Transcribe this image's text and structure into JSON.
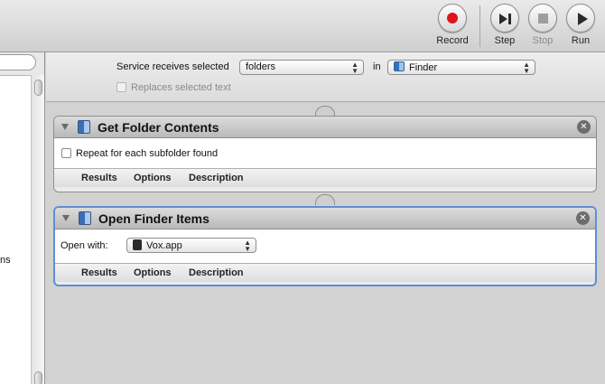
{
  "toolbar": {
    "record_label": "Record",
    "step_label": "Step",
    "stop_label": "Stop",
    "run_label": "Run"
  },
  "left": {
    "fragment_text": "ns"
  },
  "service": {
    "receives_label": "Service receives selected",
    "input_type": "folders",
    "in_label": "in",
    "application": "Finder",
    "replaces_label": "Replaces selected text"
  },
  "actions": [
    {
      "title": "Get Folder Contents",
      "option_label": "Repeat for each subfolder found",
      "tabs": [
        "Results",
        "Options",
        "Description"
      ]
    },
    {
      "title": "Open Finder Items",
      "open_with_label": "Open with:",
      "open_with_value": "Vox.app",
      "tabs": [
        "Results",
        "Options",
        "Description"
      ]
    }
  ],
  "icons": [
    "record-icon",
    "step-icon",
    "stop-icon",
    "run-icon",
    "disclosure-triangle-icon",
    "automator-icon",
    "close-icon",
    "finder-icon",
    "app-icon"
  ],
  "colors": {
    "record": "#e0141b",
    "selection": "#5d8fd6"
  }
}
